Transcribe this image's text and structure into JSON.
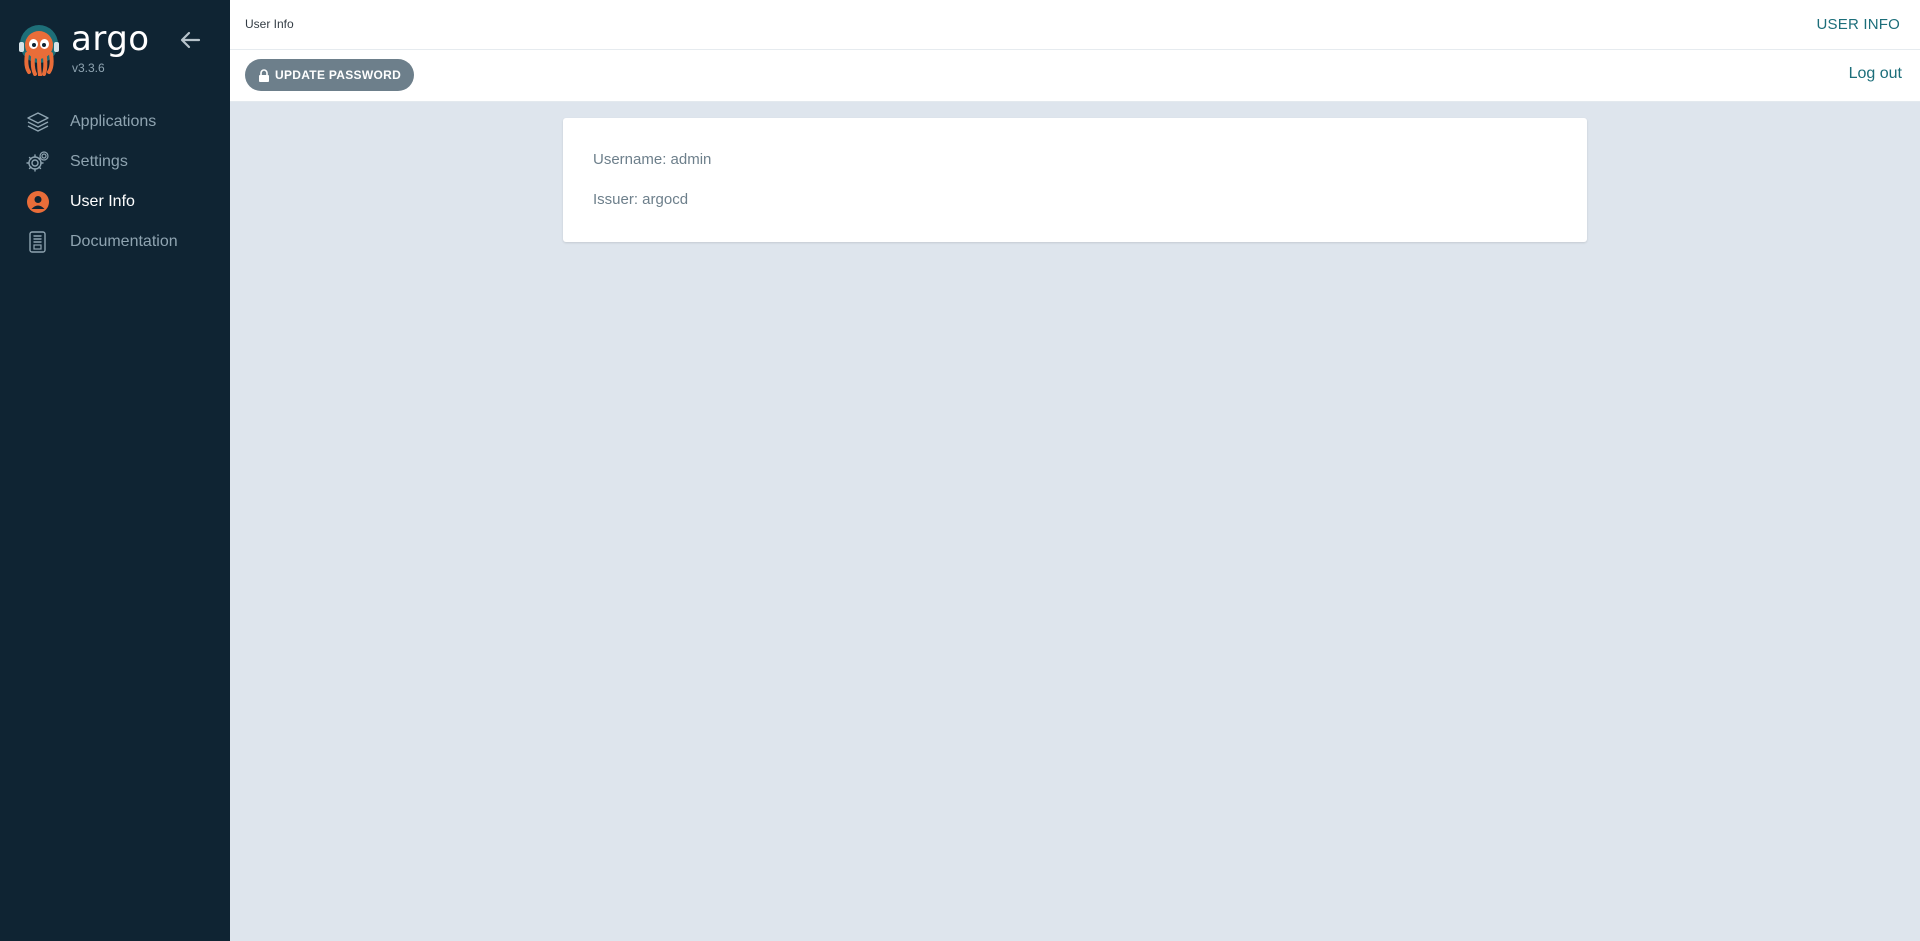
{
  "brand": {
    "name": "argo",
    "version": "v3.3.6"
  },
  "sidebar": {
    "items": [
      {
        "label": "Applications",
        "icon": "layers-icon",
        "active": false
      },
      {
        "label": "Settings",
        "icon": "gear-icon",
        "active": false
      },
      {
        "label": "User Info",
        "icon": "user-circle-icon",
        "active": true
      },
      {
        "label": "Documentation",
        "icon": "book-icon",
        "active": false
      }
    ]
  },
  "header": {
    "title": "User Info",
    "right_label": "USER INFO"
  },
  "toolbar": {
    "update_password_label": "UPDATE PASSWORD",
    "logout_label": "Log out"
  },
  "user_info": {
    "username_line": "Username: admin",
    "issuer_line": "Issuer: argocd"
  },
  "colors": {
    "sidebar_bg": "#0f2433",
    "accent_orange": "#e96d39",
    "teal_link": "#1c6e7a",
    "content_bg": "#dee5ed",
    "button_grey": "#6d7f8b"
  }
}
